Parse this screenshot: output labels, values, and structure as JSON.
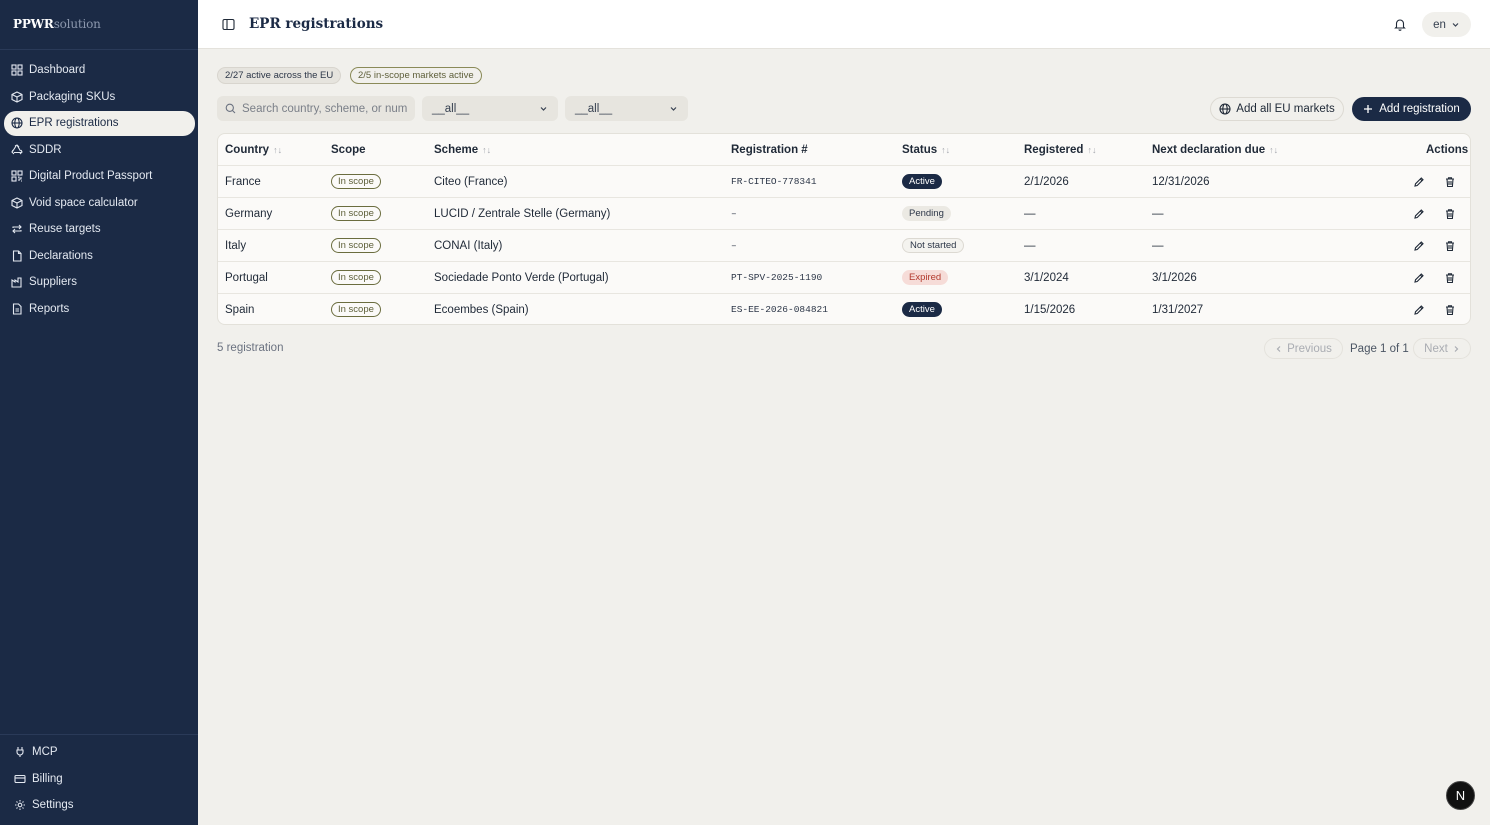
{
  "brand": {
    "bold": "PPWR",
    "light": "solution"
  },
  "sidebar": {
    "items": [
      {
        "label": "Dashboard",
        "icon": "grid-icon"
      },
      {
        "label": "Packaging SKUs",
        "icon": "package-icon"
      },
      {
        "label": "EPR registrations",
        "icon": "globe-icon",
        "active": true
      },
      {
        "label": "SDDR",
        "icon": "recycle-icon"
      },
      {
        "label": "Digital Product Passport",
        "icon": "qr-icon"
      },
      {
        "label": "Void space calculator",
        "icon": "box-icon"
      },
      {
        "label": "Reuse targets",
        "icon": "repeat-icon"
      },
      {
        "label": "Declarations",
        "icon": "file-icon"
      },
      {
        "label": "Suppliers",
        "icon": "factory-icon"
      },
      {
        "label": "Reports",
        "icon": "report-icon"
      }
    ],
    "bottom": [
      {
        "label": "MCP",
        "icon": "plug-icon"
      },
      {
        "label": "Billing",
        "icon": "card-icon"
      },
      {
        "label": "Settings",
        "icon": "gear-icon"
      }
    ]
  },
  "topbar": {
    "title": "EPR registrations",
    "lang": "en"
  },
  "badges": {
    "active_eu": "2/27 active across the EU",
    "in_scope": "2/5 in-scope markets active"
  },
  "filters": {
    "search_placeholder": "Search country, scheme, or num",
    "select1": "__all__",
    "select2": "__all__"
  },
  "buttons": {
    "add_all": "Add all EU markets",
    "add_registration": "Add registration"
  },
  "table": {
    "headers": {
      "country": "Country",
      "scope": "Scope",
      "scheme": "Scheme",
      "reg": "Registration #",
      "status": "Status",
      "registered": "Registered",
      "next": "Next declaration due",
      "actions": "Actions"
    },
    "rows": [
      {
        "country": "France",
        "scope": "In scope",
        "scheme": "Citeo (France)",
        "reg": "FR-CITEO-778341",
        "status": "Active",
        "registered": "2/1/2026",
        "next": "12/31/2026"
      },
      {
        "country": "Germany",
        "scope": "In scope",
        "scheme": "LUCID / Zentrale Stelle (Germany)",
        "reg": "–",
        "status": "Pending",
        "registered": "—",
        "next": "—"
      },
      {
        "country": "Italy",
        "scope": "In scope",
        "scheme": "CONAI (Italy)",
        "reg": "–",
        "status": "Not started",
        "registered": "—",
        "next": "—"
      },
      {
        "country": "Portugal",
        "scope": "In scope",
        "scheme": "Sociedade Ponto Verde (Portugal)",
        "reg": "PT-SPV-2025-1190",
        "status": "Expired",
        "registered": "3/1/2024",
        "next": "3/1/2026"
      },
      {
        "country": "Spain",
        "scope": "In scope",
        "scheme": "Ecoembes (Spain)",
        "reg": "ES-EE-2026-084821",
        "status": "Active",
        "registered": "1/15/2026",
        "next": "1/31/2027"
      }
    ]
  },
  "footer": {
    "count": "5 registration",
    "prev": "Previous",
    "page": "Page 1 of 1",
    "next": "Next"
  },
  "fab": {
    "label": "N"
  },
  "colors": {
    "sidebar": "#1b2a45",
    "accent": "#1b2a45",
    "background": "#f1f0ec",
    "expired": "#b23a2e"
  }
}
